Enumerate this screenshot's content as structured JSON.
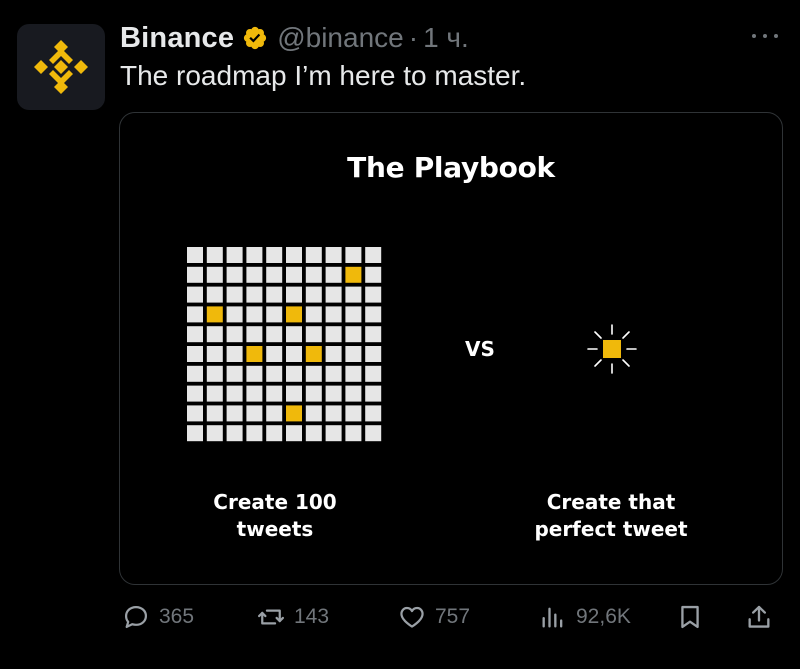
{
  "tweet": {
    "author": {
      "display_name": "Binance",
      "handle": "@binance",
      "avatar_icon": "binance-logo-icon",
      "verified_icon": "verified-badge-icon",
      "verified_color": "#F0B90B"
    },
    "separator": "·",
    "time": "1 ч.",
    "more_icon": "more-horizontal-icon",
    "text": "The roadmap I’m here to master."
  },
  "media": {
    "title": "The Playbook",
    "vs": "VS",
    "left_caption": [
      "Create 100",
      "tweets"
    ],
    "right_caption": [
      "Create that",
      "perfect tweet"
    ],
    "grid": {
      "rows": 10,
      "cols": 10,
      "highlighted_cells": [
        [
          1,
          8
        ],
        [
          3,
          1
        ],
        [
          3,
          5
        ],
        [
          5,
          3
        ],
        [
          5,
          6
        ],
        [
          8,
          5
        ]
      ]
    },
    "spark_icon": "sparkle-square-icon",
    "accent_color": "#F0B90B",
    "cell_color": "#E6E6E6"
  },
  "actions": {
    "reply": {
      "icon": "reply-icon",
      "count": "365"
    },
    "retweet": {
      "icon": "retweet-icon",
      "count": "143"
    },
    "like": {
      "icon": "heart-icon",
      "count": "757"
    },
    "views": {
      "icon": "views-bar-chart-icon",
      "count": "92,6K"
    },
    "bookmark": {
      "icon": "bookmark-icon"
    },
    "share": {
      "icon": "share-icon"
    }
  },
  "colors": {
    "background": "#000000",
    "text_primary": "#E7E9EA",
    "text_secondary": "#71767B",
    "border": "#2F3336"
  }
}
